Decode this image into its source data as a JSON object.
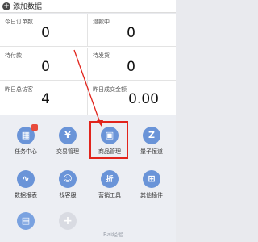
{
  "topbar": {
    "label": "添加数据"
  },
  "stats": [
    {
      "title": "今日订单数",
      "value": "0"
    },
    {
      "title": "退款中",
      "value": "0"
    },
    {
      "title": "待付款",
      "value": "0"
    },
    {
      "title": "待发货",
      "value": "0"
    },
    {
      "title": "昨日总访客",
      "value": "4"
    },
    {
      "title": "昨日成交金额",
      "value": "0.00"
    }
  ],
  "grid": [
    {
      "label": "任务中心",
      "icon": "task-calendar-icon",
      "glyph": "▦"
    },
    {
      "label": "交易管理",
      "icon": "yen-icon",
      "glyph": "¥"
    },
    {
      "label": "商品管理",
      "icon": "product-bag-icon",
      "glyph": "▣"
    },
    {
      "label": "量子恒道",
      "icon": "quantum-z-icon",
      "glyph": "Z"
    },
    {
      "label": "数据报表",
      "icon": "chart-line-icon",
      "glyph": "∿"
    },
    {
      "label": "找客服",
      "icon": "customer-service-icon",
      "glyph": "☺"
    },
    {
      "label": "营销工具",
      "icon": "discount-tag-icon",
      "glyph": "折"
    },
    {
      "label": "其他插件",
      "icon": "grid-plugin-icon",
      "glyph": "⊞"
    }
  ],
  "watermark": "Bai经验"
}
